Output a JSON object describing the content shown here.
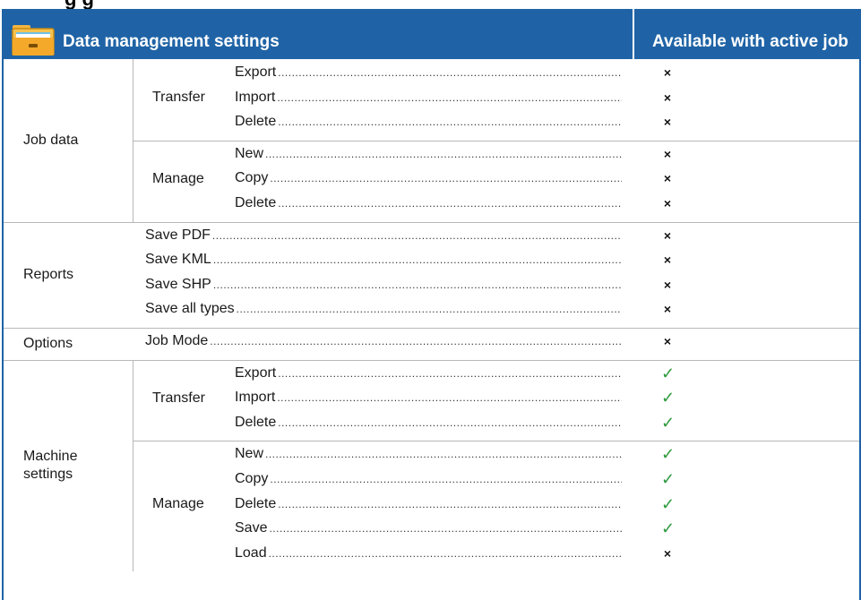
{
  "page": {
    "heading": "g      g"
  },
  "header": {
    "title": "Data management settings",
    "available_label": "Available with active job",
    "brand_color": "#1f63a6",
    "icon": "folder-icon"
  },
  "sections": [
    {
      "category": "Job data",
      "groups": [
        {
          "subcategory": "Transfer",
          "items": [
            {
              "label": "Export",
              "available": false
            },
            {
              "label": "Import",
              "available": false
            },
            {
              "label": "Delete",
              "available": false
            }
          ]
        },
        {
          "subcategory": "Manage",
          "items": [
            {
              "label": "New",
              "available": false
            },
            {
              "label": "Copy",
              "available": false
            },
            {
              "label": "Delete",
              "available": false
            }
          ]
        }
      ]
    },
    {
      "category": "Reports",
      "items": [
        {
          "label": "Save PDF",
          "available": false
        },
        {
          "label": "Save KML",
          "available": false
        },
        {
          "label": "Save SHP",
          "available": false
        },
        {
          "label": "Save all types",
          "available": false
        }
      ]
    },
    {
      "category": "Options",
      "items": [
        {
          "label": "Job Mode",
          "available": false
        }
      ]
    },
    {
      "category": "Machine\nsettings",
      "groups": [
        {
          "subcategory": "Transfer",
          "items": [
            {
              "label": "Export",
              "available": true
            },
            {
              "label": "Import",
              "available": true
            },
            {
              "label": "Delete",
              "available": true
            }
          ]
        },
        {
          "subcategory": "Manage",
          "items": [
            {
              "label": "New",
              "available": true
            },
            {
              "label": "Copy",
              "available": true
            },
            {
              "label": "Delete",
              "available": true
            },
            {
              "label": "Save",
              "available": true
            },
            {
              "label": "Load",
              "available": false
            }
          ]
        }
      ]
    }
  ],
  "symbols": {
    "yes": "✓",
    "no": "×",
    "yes_color": "#2e9a3e"
  }
}
